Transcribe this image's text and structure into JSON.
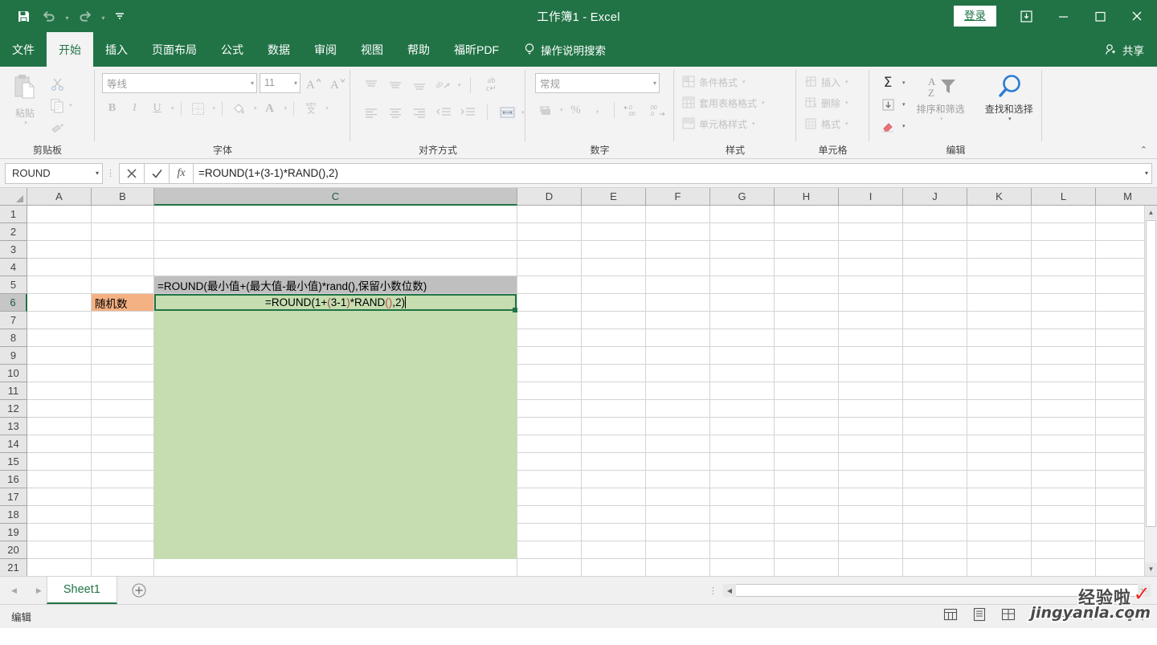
{
  "titlebar": {
    "doc_title": "工作簿1  -  Excel",
    "signin_label": "登录",
    "qat": [
      {
        "name": "save-icon",
        "label": "保存"
      },
      {
        "name": "undo-icon",
        "label": "撤消"
      },
      {
        "name": "redo-icon",
        "label": "恢复"
      },
      {
        "name": "customize-qat-icon",
        "label": "自定义快速访问工具栏"
      }
    ],
    "window_controls": [
      {
        "name": "ribbon-display-options-icon",
        "label": "功能区显示选项"
      },
      {
        "name": "minimize-icon",
        "label": "最小化"
      },
      {
        "name": "maximize-icon",
        "label": "最大化"
      },
      {
        "name": "close-icon",
        "label": "关闭"
      }
    ]
  },
  "tabs": {
    "items": [
      "文件",
      "开始",
      "插入",
      "页面布局",
      "公式",
      "数据",
      "审阅",
      "视图",
      "帮助",
      "福昕PDF"
    ],
    "active": "开始",
    "tellme_placeholder": "操作说明搜索",
    "share_label": "共享"
  },
  "ribbon": {
    "groups": [
      {
        "label": "剪贴板",
        "paste_label": "粘贴"
      },
      {
        "label": "字体"
      },
      {
        "label": "对齐方式"
      },
      {
        "label": "数字"
      },
      {
        "label": "样式"
      },
      {
        "label": "单元格"
      },
      {
        "label": "编辑"
      }
    ],
    "font": {
      "family_value": "等线",
      "size_value": "11",
      "grow_label": "A",
      "shrink_label": "A",
      "bold_label": "B",
      "italic_label": "I",
      "underline_label": "U",
      "phonetic_label": "文"
    },
    "number": {
      "format_value": "常规",
      "percent_label": "%",
      "comma_label": ",",
      "inc_decimal_label": ".00",
      "dec_decimal_label": ".00"
    },
    "styles": {
      "conditional_label": "条件格式",
      "table_label": "套用表格格式",
      "cellstyle_label": "单元格样式"
    },
    "cells": {
      "insert_label": "插入",
      "delete_label": "删除",
      "format_label": "格式"
    },
    "editing": {
      "autosum_label": "Σ",
      "sort_filter_label": "排序和筛选",
      "find_select_label": "查找和选择"
    },
    "collapse_label": "折叠功能区"
  },
  "formula_bar": {
    "name_box_value": "ROUND",
    "cancel_label": "取消",
    "enter_label": "输入",
    "fx_label": "fx",
    "formula_value": "=ROUND(1+(3-1)*RAND(),2)"
  },
  "grid": {
    "columns": [
      "A",
      "B",
      "C",
      "D",
      "E",
      "F",
      "G",
      "H",
      "I",
      "J",
      "K",
      "L",
      "M"
    ],
    "selected_column": "C",
    "rows": [
      "1",
      "2",
      "3",
      "4",
      "5",
      "6",
      "7",
      "8",
      "9",
      "10",
      "11",
      "12",
      "13",
      "14",
      "15",
      "16",
      "17",
      "18",
      "19",
      "20",
      "21"
    ],
    "selected_row": "6",
    "cells": [
      {
        "ref": "C5",
        "value": "=ROUND(最小值+(最大值-最小值)*rand(),保留小数位数)",
        "bg": "#bfbfbf",
        "align": "left"
      },
      {
        "ref": "B6",
        "value": "随机数",
        "bg": "#f4b183",
        "align": "left"
      },
      {
        "ref": "C6",
        "value": "=ROUND(1+(3-1)*RAND(),2)",
        "bg": "#c5ddb0",
        "align": "center",
        "editing": true
      }
    ],
    "editing_formula_parts": [
      {
        "text": "=ROUND",
        "color": "#000000"
      },
      {
        "text": "(",
        "color": "#000000"
      },
      {
        "text": "1+",
        "color": "#000000"
      },
      {
        "text": "(",
        "color": "#a54a4a"
      },
      {
        "text": "3-1",
        "color": "#000000"
      },
      {
        "text": ")",
        "color": "#a54a4a"
      },
      {
        "text": "*RAND",
        "color": "#000000"
      },
      {
        "text": "(",
        "color": "#c0504d"
      },
      {
        "text": ")",
        "color": "#c0504d"
      },
      {
        "text": ",2",
        "color": "#000000"
      },
      {
        "text": ")",
        "color": "#000000"
      }
    ],
    "fill_color": "#c5ddb0"
  },
  "sheetbar": {
    "tabs": [
      "Sheet1"
    ],
    "active_tab": "Sheet1",
    "add_sheet_label": "+",
    "prev_label": "◀",
    "next_label": "▶"
  },
  "statusbar": {
    "mode_text": "编辑",
    "views": [
      {
        "name": "normal-view-icon",
        "label": "普通"
      },
      {
        "name": "page-layout-view-icon",
        "label": "页面布局"
      },
      {
        "name": "page-break-view-icon",
        "label": "分页预览"
      }
    ],
    "zoom_out_label": "−",
    "zoom_in_label": "+"
  },
  "watermark": {
    "line1": "经验啦",
    "line2": "jingyanla.com",
    "check": "✓"
  },
  "colors": {
    "brand_green": "#217346",
    "selection_fill": "#c5ddb0",
    "orange_cell": "#f4b183",
    "grey_cell": "#bfbfbf"
  }
}
